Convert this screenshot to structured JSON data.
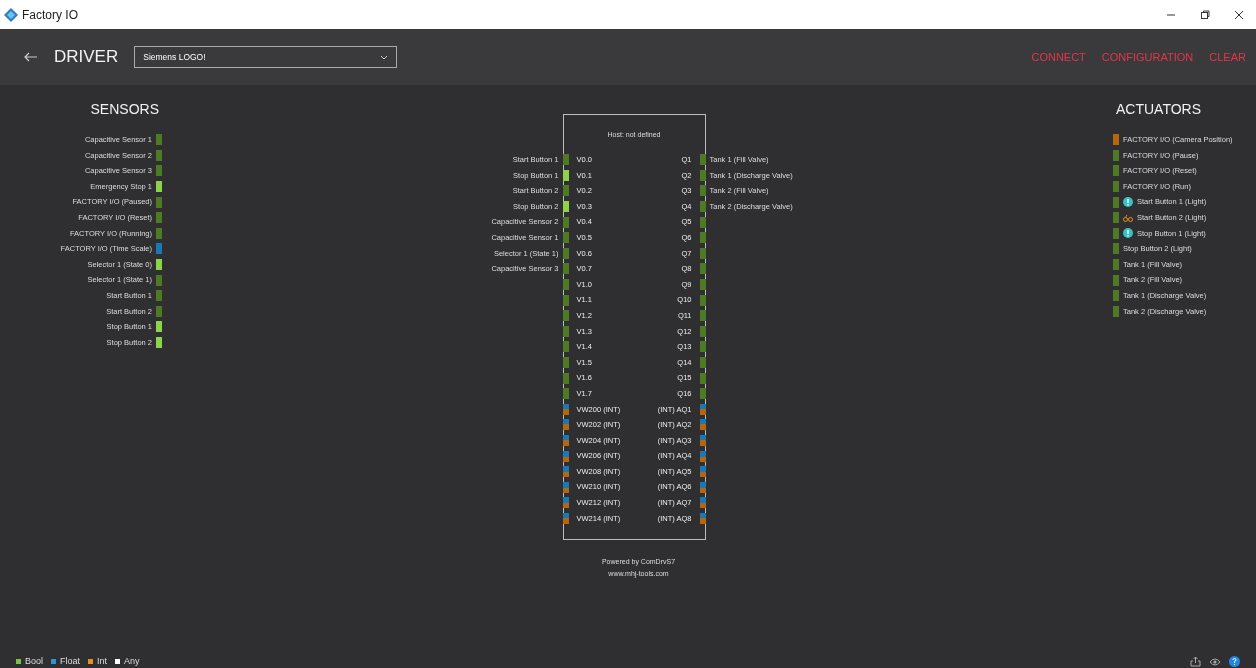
{
  "window": {
    "title": "Factory IO"
  },
  "header": {
    "title": "DRIVER",
    "driver_select": {
      "value": "Siemens LOGO!"
    },
    "actions": [
      "CONNECT",
      "CONFIGURATION",
      "CLEAR"
    ]
  },
  "sensors": {
    "title": "SENSORS",
    "items": [
      {
        "label": "Capacitive Sensor 1",
        "kind": "bool",
        "on": false
      },
      {
        "label": "Capacitive Sensor 2",
        "kind": "bool",
        "on": false
      },
      {
        "label": "Capacitive Sensor 3",
        "kind": "bool",
        "on": false
      },
      {
        "label": "Emergency Stop 1",
        "kind": "bool",
        "on": true
      },
      {
        "label": "FACTORY I/O (Paused)",
        "kind": "bool",
        "on": false
      },
      {
        "label": "FACTORY I/O (Reset)",
        "kind": "bool",
        "on": false
      },
      {
        "label": "FACTORY I/O (Running)",
        "kind": "bool",
        "on": false
      },
      {
        "label": "FACTORY I/O (Time Scale)",
        "kind": "float",
        "on": false
      },
      {
        "label": "Selector 1 (State 0)",
        "kind": "bool",
        "on": true
      },
      {
        "label": "Selector 1 (State 1)",
        "kind": "bool",
        "on": false
      },
      {
        "label": "Start Button 1",
        "kind": "bool",
        "on": false
      },
      {
        "label": "Start Button 2",
        "kind": "bool",
        "on": false
      },
      {
        "label": "Stop Button 1",
        "kind": "bool",
        "on": true
      },
      {
        "label": "Stop Button 2",
        "kind": "bool",
        "on": true
      }
    ]
  },
  "controller": {
    "host": "Host: not defined",
    "rows": [
      {
        "input": {
          "label": "Start Button 1",
          "address": "V0.0",
          "kind": "bool",
          "on": false
        },
        "output": {
          "address": "Q1",
          "kind": "bool",
          "on": false,
          "label": "Tank 1 (Fill Valve)"
        }
      },
      {
        "input": {
          "label": "Stop Button 1",
          "address": "V0.1",
          "kind": "bool",
          "on": true
        },
        "output": {
          "address": "Q2",
          "kind": "bool",
          "on": false,
          "label": "Tank 1 (Discharge Valve)"
        }
      },
      {
        "input": {
          "label": "Start Button 2",
          "address": "V0.2",
          "kind": "bool",
          "on": false
        },
        "output": {
          "address": "Q3",
          "kind": "bool",
          "on": false,
          "label": "Tank 2 (Fill Valve)"
        }
      },
      {
        "input": {
          "label": "Stop Button 2",
          "address": "V0.3",
          "kind": "bool",
          "on": true
        },
        "output": {
          "address": "Q4",
          "kind": "bool",
          "on": false,
          "label": "Tank 2 (Discharge Valve)"
        }
      },
      {
        "input": {
          "label": "Capacitive Sensor 2",
          "address": "V0.4",
          "kind": "bool",
          "on": false
        },
        "output": {
          "address": "Q5",
          "kind": "bool",
          "on": false
        }
      },
      {
        "input": {
          "label": "Capacitive Sensor 1",
          "address": "V0.5",
          "kind": "bool",
          "on": false
        },
        "output": {
          "address": "Q6",
          "kind": "bool",
          "on": false
        }
      },
      {
        "input": {
          "label": "Selector 1 (State 1)",
          "address": "V0.6",
          "kind": "bool",
          "on": false
        },
        "output": {
          "address": "Q7",
          "kind": "bool",
          "on": false
        }
      },
      {
        "input": {
          "label": "Capacitive Sensor 3",
          "address": "V0.7",
          "kind": "bool",
          "on": false
        },
        "output": {
          "address": "Q8",
          "kind": "bool",
          "on": false
        }
      },
      {
        "input": {
          "address": "V1.0",
          "kind": "bool",
          "on": false
        },
        "output": {
          "address": "Q9",
          "kind": "bool",
          "on": false
        }
      },
      {
        "input": {
          "address": "V1.1",
          "kind": "bool",
          "on": false
        },
        "output": {
          "address": "Q10",
          "kind": "bool",
          "on": false
        }
      },
      {
        "input": {
          "address": "V1.2",
          "kind": "bool",
          "on": false
        },
        "output": {
          "address": "Q11",
          "kind": "bool",
          "on": false
        }
      },
      {
        "input": {
          "address": "V1.3",
          "kind": "bool",
          "on": false
        },
        "output": {
          "address": "Q12",
          "kind": "bool",
          "on": false
        }
      },
      {
        "input": {
          "address": "V1.4",
          "kind": "bool",
          "on": false
        },
        "output": {
          "address": "Q13",
          "kind": "bool",
          "on": false
        }
      },
      {
        "input": {
          "address": "V1.5",
          "kind": "bool",
          "on": false
        },
        "output": {
          "address": "Q14",
          "kind": "bool",
          "on": false
        }
      },
      {
        "input": {
          "address": "V1.6",
          "kind": "bool",
          "on": false
        },
        "output": {
          "address": "Q15",
          "kind": "bool",
          "on": false
        }
      },
      {
        "input": {
          "address": "V1.7",
          "kind": "bool",
          "on": false
        },
        "output": {
          "address": "Q16",
          "kind": "bool",
          "on": false
        }
      },
      {
        "input": {
          "address": "VW200 (INT)",
          "kind": "mixed",
          "on": false
        },
        "output": {
          "address": "(INT) AQ1",
          "kind": "mixed",
          "on": false
        }
      },
      {
        "input": {
          "address": "VW202 (INT)",
          "kind": "mixed",
          "on": false
        },
        "output": {
          "address": "(INT) AQ2",
          "kind": "mixed",
          "on": false
        }
      },
      {
        "input": {
          "address": "VW204 (INT)",
          "kind": "mixed",
          "on": false
        },
        "output": {
          "address": "(INT) AQ3",
          "kind": "mixed",
          "on": false
        }
      },
      {
        "input": {
          "address": "VW206 (INT)",
          "kind": "mixed",
          "on": false
        },
        "output": {
          "address": "(INT) AQ4",
          "kind": "mixed",
          "on": false
        }
      },
      {
        "input": {
          "address": "VW208 (INT)",
          "kind": "mixed",
          "on": false
        },
        "output": {
          "address": "(INT) AQ5",
          "kind": "mixed",
          "on": false
        }
      },
      {
        "input": {
          "address": "VW210 (INT)",
          "kind": "mixed",
          "on": false
        },
        "output": {
          "address": "(INT) AQ6",
          "kind": "mixed",
          "on": false
        }
      },
      {
        "input": {
          "address": "VW212 (INT)",
          "kind": "mixed",
          "on": false
        },
        "output": {
          "address": "(INT) AQ7",
          "kind": "mixed",
          "on": false
        }
      },
      {
        "input": {
          "address": "VW214 (INT)",
          "kind": "mixed",
          "on": false
        },
        "output": {
          "address": "(INT) AQ8",
          "kind": "mixed",
          "on": false
        }
      }
    ],
    "footer": [
      "Powered by ComDrvS7",
      "www.mhj-tools.com"
    ]
  },
  "actuators": {
    "title": "ACTUATORS",
    "items": [
      {
        "label": "FACTORY I/O (Camera Position)",
        "kind": "int",
        "on": false,
        "alert": false,
        "linked": false
      },
      {
        "label": "FACTORY I/O (Pause)",
        "kind": "bool",
        "on": false,
        "alert": false,
        "linked": false
      },
      {
        "label": "FACTORY I/O (Reset)",
        "kind": "bool",
        "on": false,
        "alert": false,
        "linked": false
      },
      {
        "label": "FACTORY I/O (Run)",
        "kind": "bool",
        "on": false,
        "alert": false,
        "linked": false
      },
      {
        "label": "Start Button 1 (Light)",
        "kind": "bool",
        "on": false,
        "alert": true,
        "linked": false
      },
      {
        "label": "Start Button 2 (Light)",
        "kind": "bool",
        "on": false,
        "alert": false,
        "linked": true
      },
      {
        "label": "Stop Button 1 (Light)",
        "kind": "bool",
        "on": false,
        "alert": true,
        "linked": false
      },
      {
        "label": "Stop Button 2 (Light)",
        "kind": "bool",
        "on": false,
        "alert": false,
        "linked": false
      },
      {
        "label": "Tank 1 (Fill Valve)",
        "kind": "bool",
        "on": false,
        "alert": false,
        "linked": false
      },
      {
        "label": "Tank 2 (Fill Valve)",
        "kind": "bool",
        "on": false,
        "alert": false,
        "linked": false
      },
      {
        "label": "Tank 1 (Discharge Valve)",
        "kind": "bool",
        "on": false,
        "alert": false,
        "linked": false
      },
      {
        "label": "Tank 2 (Discharge Valve)",
        "kind": "bool",
        "on": false,
        "alert": false,
        "linked": false
      }
    ]
  },
  "legend": [
    {
      "label": "Bool",
      "color": "#7cc242"
    },
    {
      "label": "Float",
      "color": "#2a93d5"
    },
    {
      "label": "Int",
      "color": "#e8901c"
    },
    {
      "label": "Any",
      "color": "#ffffff"
    }
  ]
}
